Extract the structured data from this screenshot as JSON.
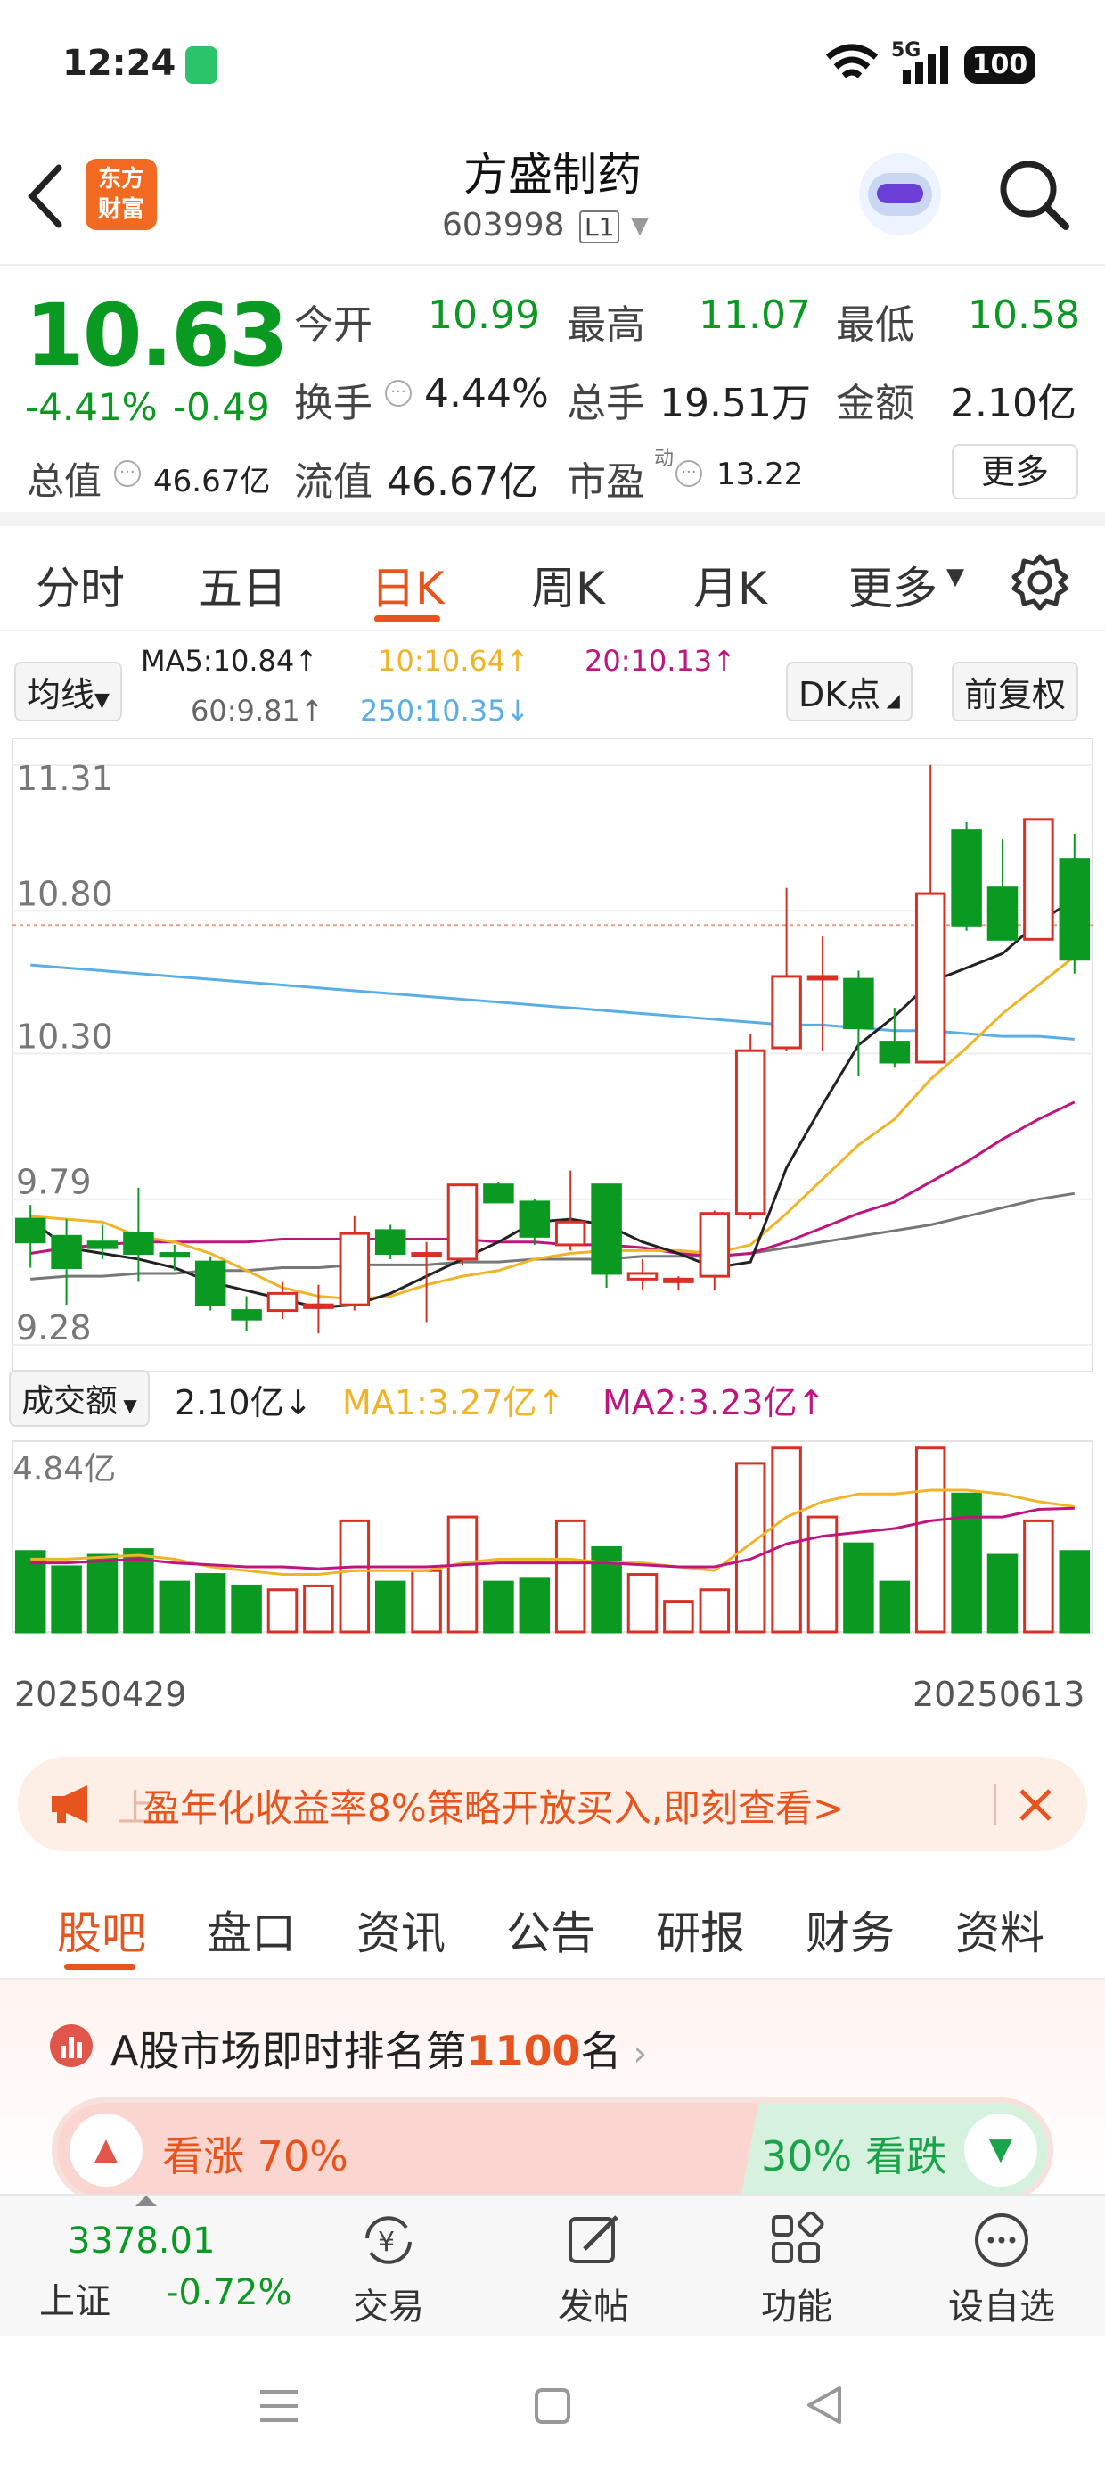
{
  "status": {
    "time": "12:24",
    "network": "5G",
    "battery": "100"
  },
  "header": {
    "title": "方盛制药",
    "code": "603998",
    "level": "L1",
    "logo_line1": "东方",
    "logo_line2": "财富"
  },
  "quote": {
    "price": "10.63",
    "change_pct": "-4.41%",
    "change_abs": "-0.49",
    "open_label": "今开",
    "open": "10.99",
    "high_label": "最高",
    "high": "11.07",
    "low_label": "最低",
    "low": "10.58",
    "turnover_label": "换手",
    "turnover": "4.44%",
    "volume_label": "总手",
    "volume": "19.51万",
    "amount_label": "金额",
    "amount": "2.10亿",
    "mktcap_label": "总值",
    "mktcap": "46.67亿",
    "float_label": "流值",
    "float_cap": "46.67亿",
    "pe_label": "市盈",
    "pe_sup": "动",
    "pe": "13.22",
    "more_button": "更多"
  },
  "period_tabs": [
    "分时",
    "五日",
    "日K",
    "周K",
    "月K",
    "更多"
  ],
  "active_period": "日K",
  "chart": {
    "indicator_select": "均线",
    "ma5": "MA5:10.84↑",
    "ma10": "10:10.64↑",
    "ma20": "20:10.13↑",
    "ma60": "60:9.81↑",
    "ma250": "250:10.35↓",
    "dk_button": "DK点",
    "adjust_button": "前复权",
    "y_ticks": [
      "11.31",
      "10.80",
      "10.30",
      "9.79",
      "9.28"
    ],
    "vol_select": "成交额",
    "vol_value": "2.10亿↓",
    "vol_ma1": "MA1:3.27亿↑",
    "vol_ma2": "MA2:3.23亿↑",
    "vol_max": "4.84亿",
    "date_start": "20250429",
    "date_end": "20250613",
    "colors": {
      "up": "#d93026",
      "down": "#0a9a22",
      "ma5": "#222222",
      "ma10": "#f0b429",
      "ma20": "#c0157f",
      "ma60": "#777777",
      "ma250": "#5aaee8"
    }
  },
  "chart_data": {
    "type": "candlestick",
    "ylim": [
      9.28,
      11.31
    ],
    "candles": [
      {
        "o": 9.72,
        "c": 9.64,
        "h": 9.77,
        "l": 9.55
      },
      {
        "o": 9.66,
        "c": 9.55,
        "h": 9.72,
        "l": 9.42
      },
      {
        "o": 9.64,
        "c": 9.62,
        "h": 9.7,
        "l": 9.58
      },
      {
        "o": 9.67,
        "c": 9.6,
        "h": 9.83,
        "l": 9.5
      },
      {
        "o": 9.6,
        "c": 9.59,
        "h": 9.63,
        "l": 9.54
      },
      {
        "o": 9.57,
        "c": 9.42,
        "h": 9.59,
        "l": 9.4
      },
      {
        "o": 9.4,
        "c": 9.37,
        "h": 9.45,
        "l": 9.33
      },
      {
        "o": 9.4,
        "c": 9.46,
        "h": 9.5,
        "l": 9.37
      },
      {
        "o": 9.41,
        "c": 9.42,
        "h": 9.49,
        "l": 9.32
      },
      {
        "o": 9.42,
        "c": 9.67,
        "h": 9.73,
        "l": 9.4
      },
      {
        "o": 9.68,
        "c": 9.6,
        "h": 9.7,
        "l": 9.58
      },
      {
        "o": 9.6,
        "c": 9.6,
        "h": 9.64,
        "l": 9.36
      },
      {
        "o": 9.58,
        "c": 9.84,
        "h": 9.84,
        "l": 9.56
      },
      {
        "o": 9.84,
        "c": 9.78,
        "h": 9.85,
        "l": 9.79
      },
      {
        "o": 9.78,
        "c": 9.66,
        "h": 9.79,
        "l": 9.63
      },
      {
        "o": 9.63,
        "c": 9.71,
        "h": 9.89,
        "l": 9.61
      },
      {
        "o": 9.84,
        "c": 9.53,
        "h": 9.83,
        "l": 9.48
      },
      {
        "o": 9.51,
        "c": 9.53,
        "h": 9.58,
        "l": 9.47
      },
      {
        "o": 9.51,
        "c": 9.51,
        "h": 9.52,
        "l": 9.47
      },
      {
        "o": 9.52,
        "c": 9.74,
        "h": 9.75,
        "l": 9.47
      },
      {
        "o": 9.74,
        "c": 10.31,
        "h": 10.37,
        "l": 9.72
      },
      {
        "o": 10.32,
        "c": 10.57,
        "h": 10.88,
        "l": 10.31
      },
      {
        "o": 10.57,
        "c": 10.57,
        "h": 10.71,
        "l": 10.31
      },
      {
        "o": 10.56,
        "c": 10.39,
        "h": 10.59,
        "l": 10.22
      },
      {
        "o": 10.34,
        "c": 10.27,
        "h": 10.46,
        "l": 10.25
      },
      {
        "o": 10.27,
        "c": 10.86,
        "h": 11.31,
        "l": 10.28
      },
      {
        "o": 11.08,
        "c": 10.75,
        "h": 11.11,
        "l": 10.73
      },
      {
        "o": 10.88,
        "c": 10.7,
        "h": 11.05,
        "l": 10.7
      },
      {
        "o": 10.7,
        "c": 11.12,
        "h": 11.12,
        "l": 10.7
      },
      {
        "o": 10.98,
        "c": 10.63,
        "h": 11.07,
        "l": 10.58
      }
    ],
    "volume": [
      2.1,
      1.7,
      2.0,
      2.15,
      1.3,
      1.5,
      1.2,
      1.1,
      1.2,
      2.9,
      1.3,
      1.6,
      3.0,
      1.3,
      1.4,
      2.9,
      2.2,
      1.5,
      0.8,
      1.1,
      4.4,
      4.8,
      3.0,
      2.3,
      1.3,
      4.8,
      3.6,
      2.0,
      2.9,
      2.1
    ],
    "ma5": [
      9.72,
      9.62,
      9.6,
      9.58,
      9.55,
      9.5,
      9.47,
      9.44,
      9.41,
      9.42,
      9.46,
      9.52,
      9.58,
      9.64,
      9.71,
      9.72,
      9.7,
      9.64,
      9.6,
      9.55,
      9.57,
      9.9,
      10.12,
      10.33,
      10.43,
      10.55,
      10.6,
      10.65,
      10.76,
      10.84
    ],
    "ma10": [
      9.73,
      9.72,
      9.71,
      9.66,
      9.64,
      9.6,
      9.54,
      9.48,
      9.45,
      9.44,
      9.45,
      9.49,
      9.52,
      9.54,
      9.58,
      9.6,
      9.61,
      9.61,
      9.61,
      9.6,
      9.63,
      9.74,
      9.86,
      9.98,
      10.07,
      10.21,
      10.32,
      10.44,
      10.54,
      10.64
    ],
    "ma20": [
      9.6,
      9.62,
      9.63,
      9.64,
      9.64,
      9.64,
      9.64,
      9.65,
      9.65,
      9.65,
      9.65,
      9.65,
      9.65,
      9.64,
      9.64,
      9.63,
      9.63,
      9.62,
      9.6,
      9.59,
      9.6,
      9.64,
      9.69,
      9.74,
      9.78,
      9.85,
      9.92,
      10.0,
      10.07,
      10.13
    ],
    "ma60": [
      9.51,
      9.52,
      9.52,
      9.53,
      9.53,
      9.54,
      9.54,
      9.55,
      9.55,
      9.56,
      9.56,
      9.56,
      9.57,
      9.57,
      9.58,
      9.58,
      9.58,
      9.59,
      9.59,
      9.59,
      9.6,
      9.62,
      9.64,
      9.66,
      9.68,
      9.7,
      9.73,
      9.76,
      9.79,
      9.81
    ],
    "ma250": [
      10.61,
      10.6,
      10.59,
      10.58,
      10.57,
      10.56,
      10.55,
      10.54,
      10.53,
      10.52,
      10.51,
      10.5,
      10.49,
      10.48,
      10.47,
      10.46,
      10.45,
      10.44,
      10.43,
      10.42,
      10.41,
      10.4,
      10.4,
      10.39,
      10.38,
      10.38,
      10.37,
      10.36,
      10.36,
      10.35
    ],
    "vol_ma1": [
      1.9,
      1.9,
      1.95,
      2.0,
      1.9,
      1.7,
      1.6,
      1.5,
      1.5,
      1.6,
      1.6,
      1.6,
      1.8,
      1.9,
      1.9,
      1.9,
      1.8,
      1.8,
      1.7,
      1.6,
      2.3,
      3.0,
      3.4,
      3.6,
      3.6,
      3.7,
      3.7,
      3.6,
      3.4,
      3.27
    ],
    "vol_ma2": [
      1.8,
      1.8,
      1.85,
      1.9,
      1.8,
      1.75,
      1.7,
      1.7,
      1.65,
      1.7,
      1.7,
      1.7,
      1.75,
      1.8,
      1.8,
      1.8,
      1.8,
      1.75,
      1.7,
      1.7,
      1.9,
      2.3,
      2.5,
      2.6,
      2.7,
      2.9,
      3.0,
      3.0,
      3.2,
      3.23
    ],
    "vol_ylim": [
      0,
      4.84
    ]
  },
  "ad_banner": {
    "text": "盈年化收益率8%策略开放买入,即刻查看>",
    "prefix": "上"
  },
  "sub_tabs": [
    "股吧",
    "盘口",
    "资讯",
    "公告",
    "研报",
    "财务",
    "资料"
  ],
  "active_sub_tab": "股吧",
  "ranking": {
    "prefix": "A股市场即时排名第",
    "rank": "1100",
    "suffix": "名"
  },
  "sentiment": {
    "up_label": "看涨 70%",
    "down_label": "30% 看跌",
    "up_pct": 70
  },
  "bottom_nav": {
    "index_value": "3378.01",
    "index_name": "上证",
    "index_change": "-0.72%",
    "trade": "交易",
    "post": "发帖",
    "features": "功能",
    "watchlist": "设自选"
  }
}
